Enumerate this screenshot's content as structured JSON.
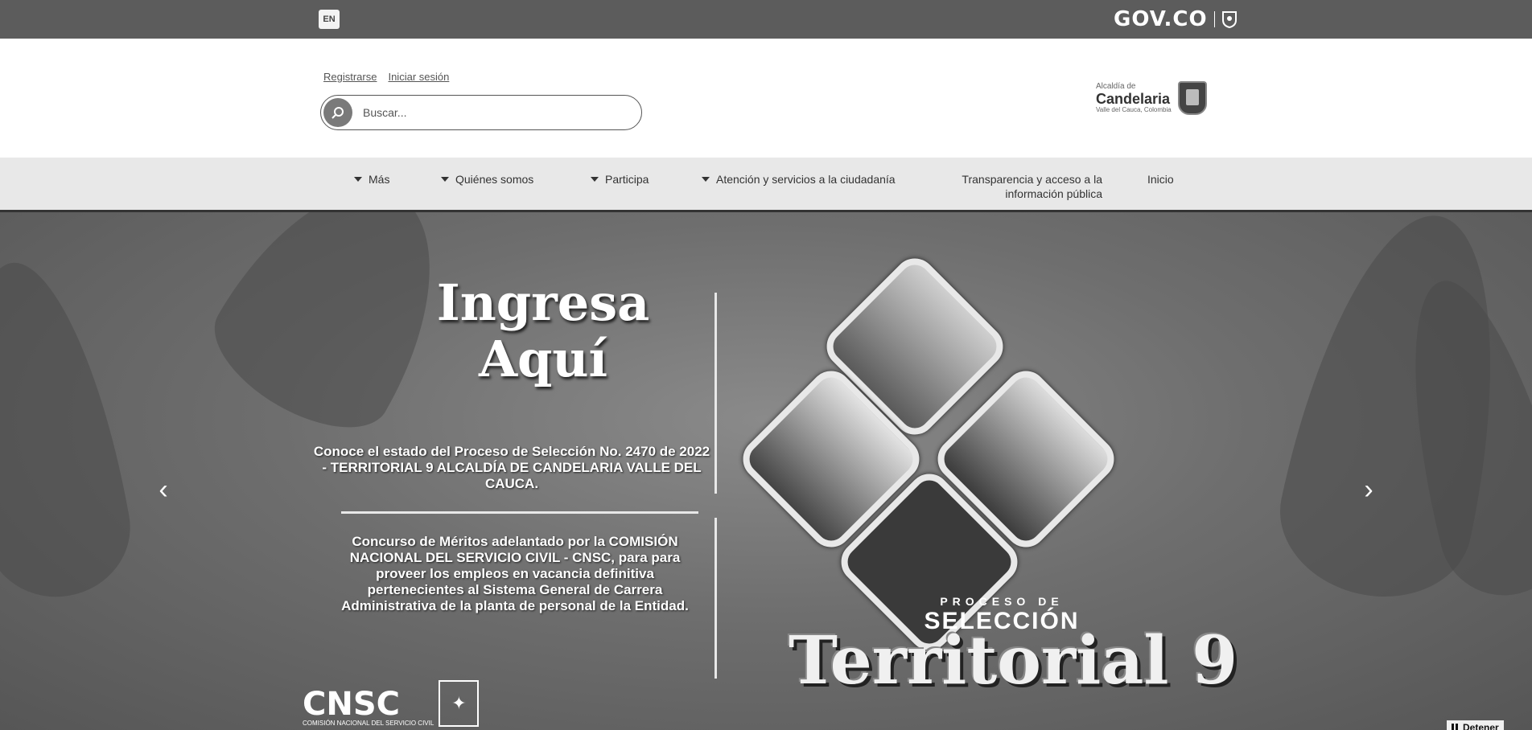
{
  "govbar": {
    "logo_text": "GOV.CO",
    "language_button": "EN"
  },
  "header": {
    "brand": {
      "line1": "Alcaldía de",
      "line2": "Candelaria",
      "line3": "Valle del Cauca, Colombia"
    },
    "login_link": "Iniciar sesión",
    "register_link": "Registrarse",
    "search": {
      "placeholder": "Buscar..."
    }
  },
  "nav": {
    "items": [
      {
        "label": "Inicio",
        "has_dropdown": false
      },
      {
        "label": "Transparencia y acceso a la información pública",
        "has_dropdown": false
      },
      {
        "label": "Atención y servicios a la ciudadanía",
        "has_dropdown": true
      },
      {
        "label": "Participa",
        "has_dropdown": true
      },
      {
        "label": "Quiénes somos",
        "has_dropdown": true
      },
      {
        "label": "Más",
        "has_dropdown": true
      }
    ]
  },
  "hero": {
    "headline_line1": "Ingresa",
    "headline_line2": "Aquí",
    "paragraph1": "Conoce el estado del Proceso de Selección No. 2470 de 2022 - TERRITORIAL 9 ALCALDÍA DE CANDELARIA VALLE DEL CAUCA.",
    "paragraph2": "Concurso de Méritos adelantado por la COMISIÓN NACIONAL DEL SERVICIO CIVIL - CNSC, para para proveer los empleos en vacancia definitiva pertenecientes al Sistema General de Carrera Administrativa de la planta de personal de la Entidad.",
    "process_small": "PROCESO DE",
    "process_big": "SELECCIÓN",
    "territorial": "Territorial 9",
    "cnsc_logo": "CNSC",
    "cnsc_sub": "COMISIÓN NACIONAL DEL SERVICIO CIVIL",
    "prev_icon": "chevron-left-icon",
    "next_icon": "chevron-right-icon",
    "stop_label": "Detener"
  },
  "colors": {
    "govbar_bg": "#5c5c5c",
    "nav_bg": "#e8e8e8",
    "search_button": "#7a7a7a"
  }
}
